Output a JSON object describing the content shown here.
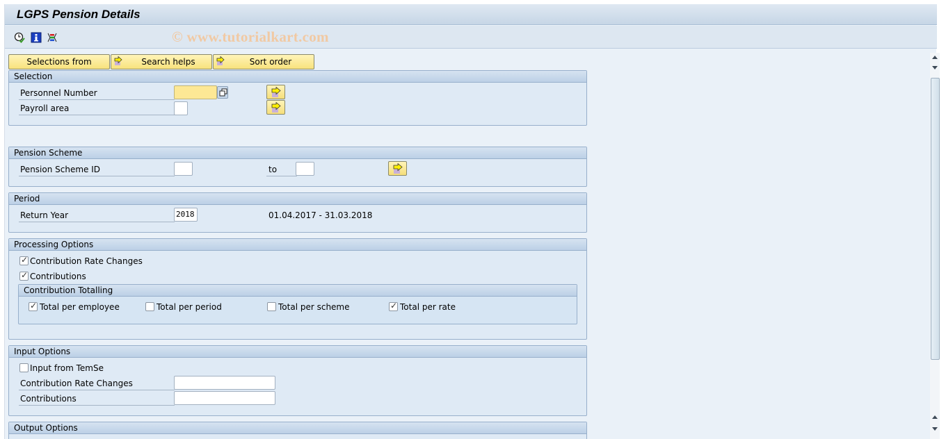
{
  "window": {
    "title": "LGPS Pension Details"
  },
  "toolbar": {
    "icons": [
      "execute-icon",
      "info-icon",
      "selection-options-icon"
    ],
    "watermark": "© www.tutorialkart.com"
  },
  "buttons": {
    "selections_from": "Selections from",
    "search_helps": "Search helps",
    "sort_order": "Sort order"
  },
  "selection": {
    "title": "Selection",
    "personnel_number": {
      "label": "Personnel Number",
      "value": ""
    },
    "payroll_area": {
      "label": "Payroll area",
      "value": ""
    }
  },
  "pension_scheme": {
    "title": "Pension Scheme",
    "scheme_id": {
      "label": "Pension Scheme ID",
      "from": "",
      "to_label": "to",
      "to": ""
    }
  },
  "period": {
    "title": "Period",
    "return_year": {
      "label": "Return Year",
      "value": "2018"
    },
    "range_text": "01.04.2017 - 31.03.2018"
  },
  "processing": {
    "title": "Processing Options",
    "rate_changes": {
      "label": "Contribution Rate Changes",
      "checked": true
    },
    "contributions": {
      "label": "Contributions",
      "checked": true
    },
    "totalling": {
      "title": "Contribution Totalling",
      "per_employee": {
        "label": "Total per employee",
        "checked": true
      },
      "per_period": {
        "label": "Total per period",
        "checked": false
      },
      "per_scheme": {
        "label": "Total per scheme",
        "checked": false
      },
      "per_rate": {
        "label": "Total per rate",
        "checked": true
      }
    }
  },
  "input_options": {
    "title": "Input Options",
    "from_temse": {
      "label": "Input from TemSe",
      "checked": false
    },
    "rate_changes": {
      "label": "Contribution Rate Changes",
      "value": ""
    },
    "contributions": {
      "label": "Contributions",
      "value": ""
    }
  },
  "output_options": {
    "title": "Output Options"
  }
}
